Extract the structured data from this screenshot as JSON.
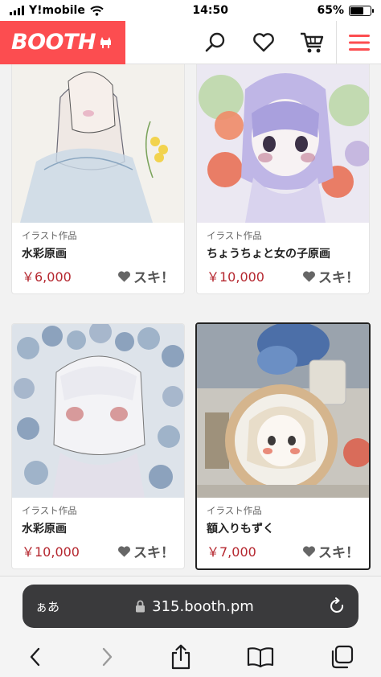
{
  "status": {
    "carrier": "Y!mobile",
    "time": "14:50",
    "battery": "65%",
    "battery_level": 0.65
  },
  "header": {
    "logo": "BOOTH"
  },
  "items": [
    {
      "category": "イラスト作品",
      "title": "水彩原画",
      "price": "￥6,000",
      "like": "スキ！"
    },
    {
      "category": "イラスト作品",
      "title": "ちょうちょと女の子原画",
      "price": "￥10,000",
      "like": "スキ！"
    },
    {
      "category": "イラスト作品",
      "title": "水彩原画",
      "price": "￥10,000",
      "like": "スキ！"
    },
    {
      "category": "イラスト作品",
      "title": "額入りもずく",
      "price": "￥7,000",
      "like": "スキ！"
    }
  ],
  "safari": {
    "aa": "ぁあ",
    "url": "315.booth.pm"
  },
  "colors": {
    "brand": "#fc4d50",
    "price": "#b5272f"
  }
}
